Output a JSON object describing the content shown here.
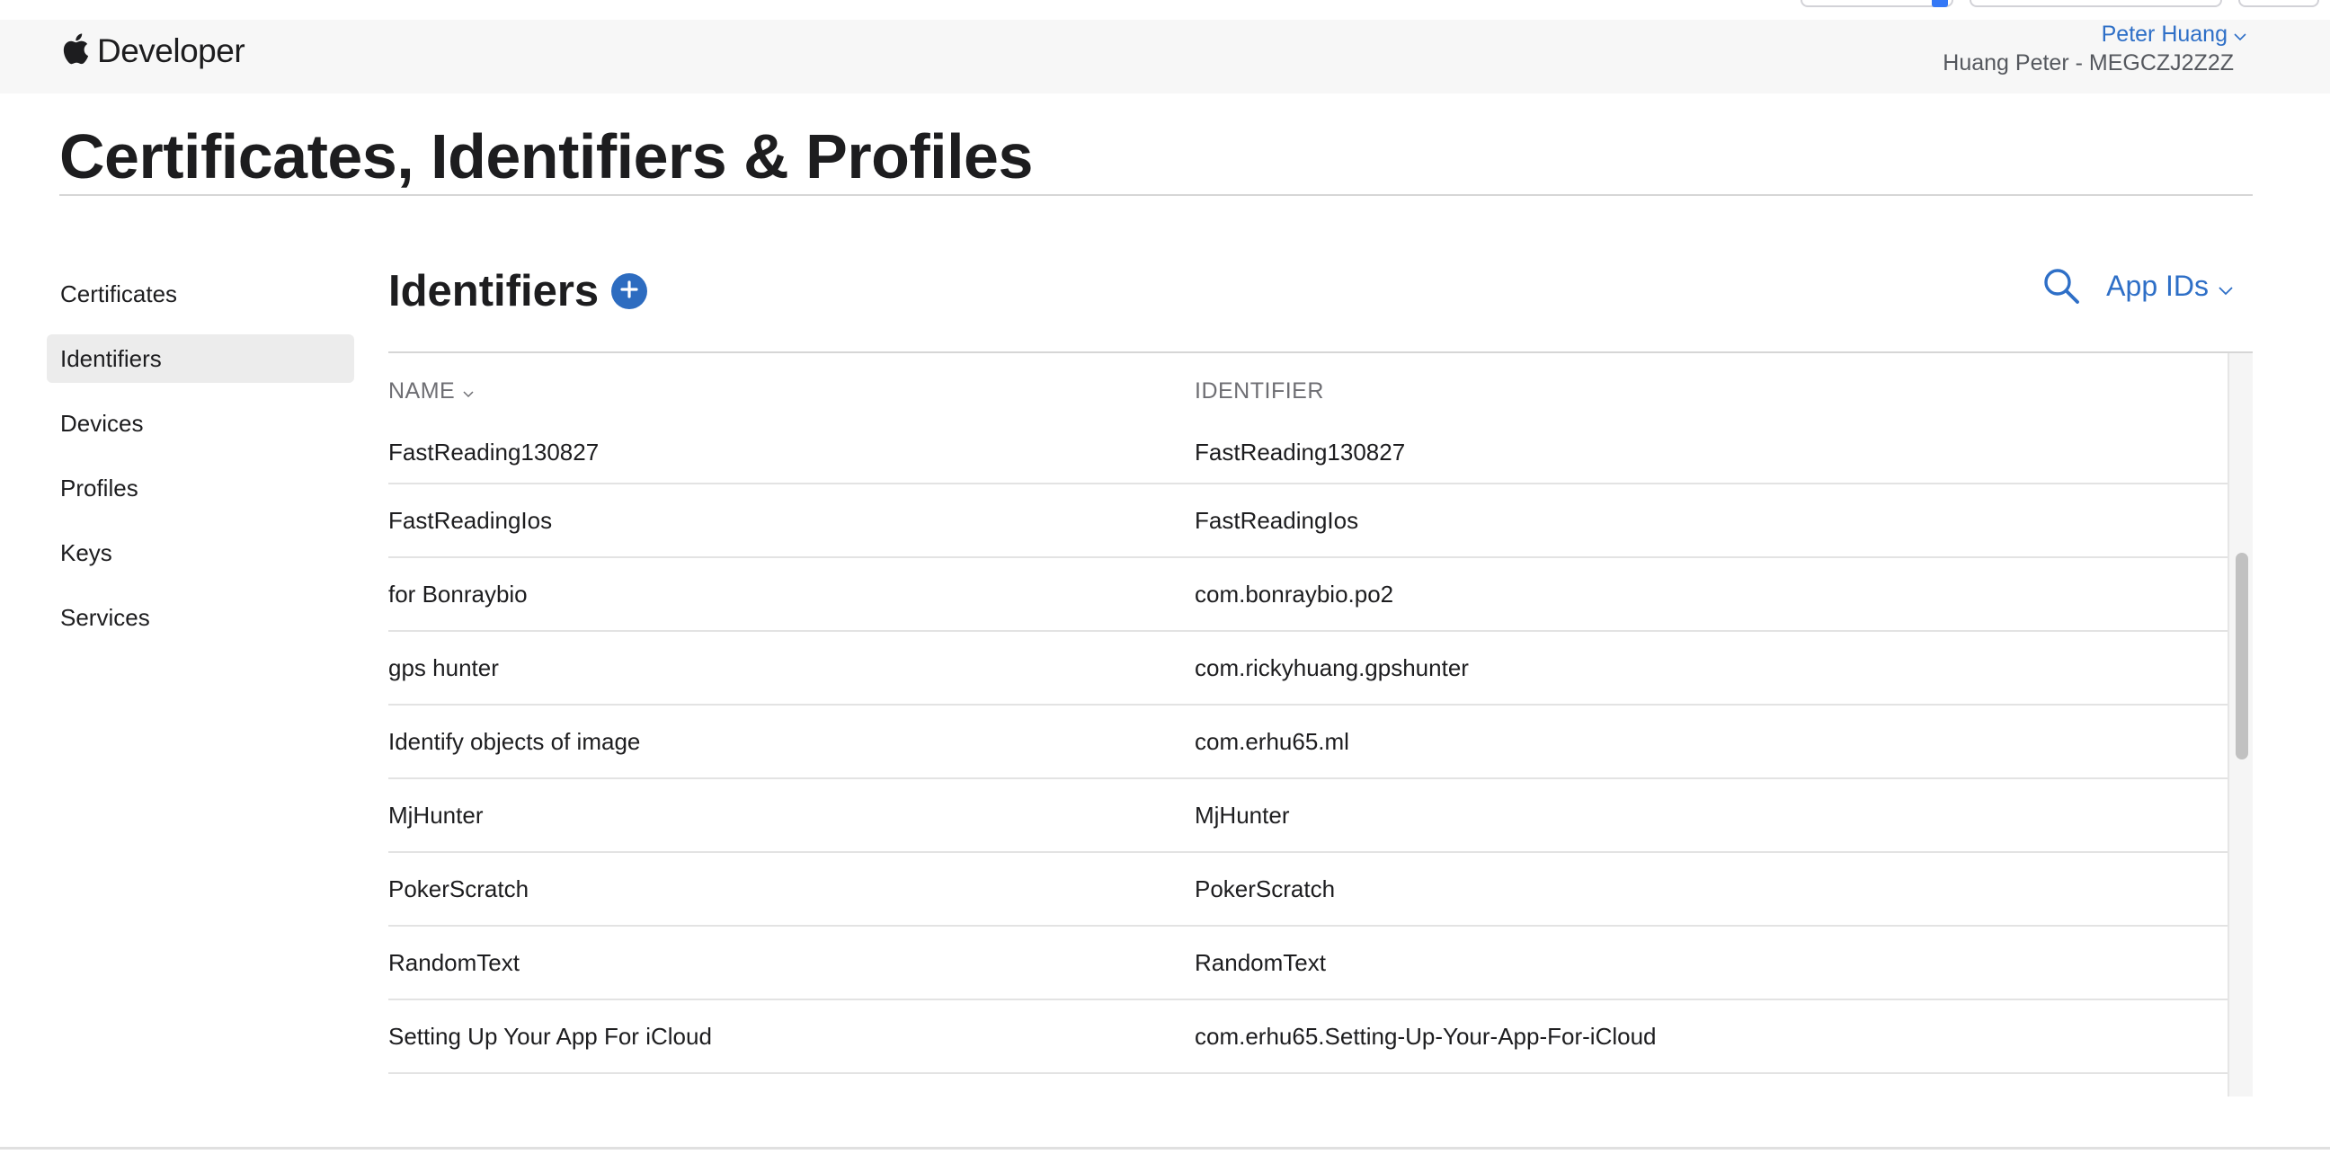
{
  "brand": {
    "name": "Developer"
  },
  "account": {
    "name": "Peter Huang",
    "team": "Huang Peter - MEGCZJ2Z2Z"
  },
  "page": {
    "title": "Certificates, Identifiers & Profiles"
  },
  "sidebar": {
    "items": [
      {
        "label": "Certificates",
        "active": false
      },
      {
        "label": "Identifiers",
        "active": true
      },
      {
        "label": "Devices",
        "active": false
      },
      {
        "label": "Profiles",
        "active": false
      },
      {
        "label": "Keys",
        "active": false
      },
      {
        "label": "Services",
        "active": false
      }
    ]
  },
  "section": {
    "title": "Identifiers",
    "filter_label": "App IDs"
  },
  "table": {
    "columns": {
      "name": "NAME",
      "identifier": "IDENTIFIER"
    },
    "rows": [
      {
        "name": "FastReading130827",
        "identifier": "FastReading130827"
      },
      {
        "name": "FastReadingIos",
        "identifier": "FastReadingIos"
      },
      {
        "name": "for Bonraybio",
        "identifier": "com.bonraybio.po2"
      },
      {
        "name": "gps hunter",
        "identifier": "com.rickyhuang.gpshunter"
      },
      {
        "name": "Identify objects of image",
        "identifier": "com.erhu65.ml"
      },
      {
        "name": "MjHunter",
        "identifier": "MjHunter"
      },
      {
        "name": "PokerScratch",
        "identifier": "PokerScratch"
      },
      {
        "name": "RandomText",
        "identifier": "RandomText"
      },
      {
        "name": "Setting Up Your App For iCloud",
        "identifier": "com.erhu65.Setting-Up-Your-App-For-iCloud"
      }
    ]
  },
  "colors": {
    "accent": "#2e6fc7",
    "add_button": "#2d6cc0",
    "active_bg": "#ececec",
    "nav_bg": "#f7f7f7"
  },
  "icons": {
    "brand": "apple-logo-icon",
    "account_menu": "chevron-down-icon",
    "add": "plus-icon",
    "search": "search-icon",
    "filter_menu": "chevron-down-icon",
    "sort": "chevron-down-icon"
  }
}
